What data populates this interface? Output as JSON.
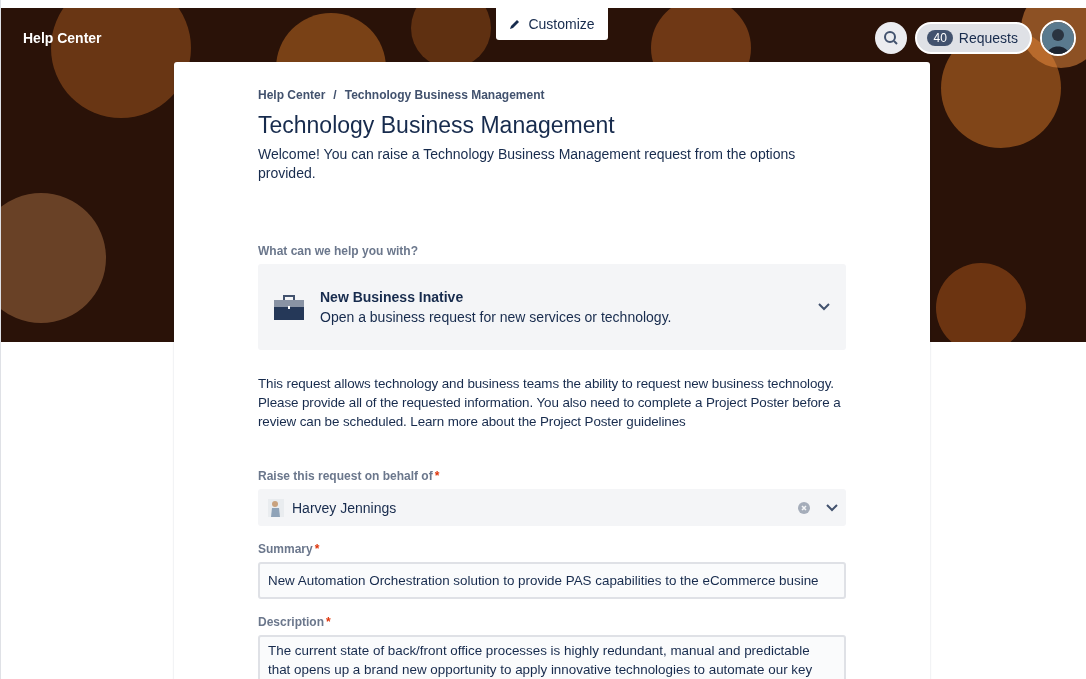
{
  "header": {
    "title": "Help Center",
    "customize_button": "Customize",
    "requests": {
      "count": "40",
      "label": "Requests"
    }
  },
  "breadcrumb": {
    "items": [
      "Help Center",
      "Technology Business Management"
    ],
    "separator": "/"
  },
  "portal": {
    "title": "Technology Business Management",
    "welcome": "Welcome! You can raise a Technology Business Management request from the options provided."
  },
  "request_type": {
    "label": "What can we help you with?",
    "name": "New Business Inative",
    "description": "Open a business request for new services or technology."
  },
  "request_info": "This request allows technology and business teams the ability to request new business technology. Please provide all of the requested information. You also need to complete a Project Poster before a review can be scheduled. Learn more about the Project Poster guidelines",
  "fields": [
    {
      "kind": "user",
      "label": "Raise this request on behalf of",
      "required_mark": "*",
      "value": "Harvey Jennings"
    },
    {
      "kind": "text",
      "label": "Summary",
      "required_mark": "*",
      "value": "New Automation Orchestration solution to provide PAS capabilities to the eCommerce busine"
    },
    {
      "kind": "textarea",
      "label": "Description",
      "required_mark": "*",
      "lines": [
        "The current state of back/front office processes is highly redundant, manual and predictable",
        "that opens up a brand new opportunity to apply innovative technologies to automate our key"
      ]
    }
  ]
}
